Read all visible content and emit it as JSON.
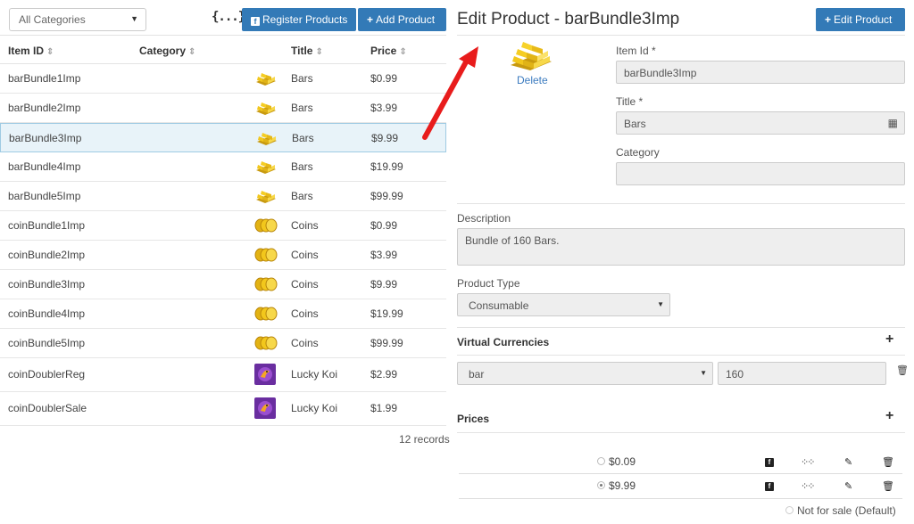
{
  "toolbar": {
    "category_select": "All Categories",
    "json_label": "{...}",
    "register_button": "Register Products",
    "add_button": "Add Product"
  },
  "table": {
    "headers": {
      "item_id": "Item ID",
      "category": "Category",
      "title": "Title",
      "price": "Price"
    },
    "rows": [
      {
        "id": "barBundle1Imp",
        "title": "Bars",
        "price": "$0.99",
        "icon": "gold-bars-icon"
      },
      {
        "id": "barBundle2Imp",
        "title": "Bars",
        "price": "$3.99",
        "icon": "gold-bars-icon"
      },
      {
        "id": "barBundle3Imp",
        "title": "Bars",
        "price": "$9.99",
        "icon": "gold-bars-icon"
      },
      {
        "id": "barBundle4Imp",
        "title": "Bars",
        "price": "$19.99",
        "icon": "gold-bars-icon"
      },
      {
        "id": "barBundle5Imp",
        "title": "Bars",
        "price": "$99.99",
        "icon": "gold-bars-icon"
      },
      {
        "id": "coinBundle1Imp",
        "title": "Coins",
        "price": "$0.99",
        "icon": "gold-coins-icon"
      },
      {
        "id": "coinBundle2Imp",
        "title": "Coins",
        "price": "$3.99",
        "icon": "gold-coins-icon"
      },
      {
        "id": "coinBundle3Imp",
        "title": "Coins",
        "price": "$9.99",
        "icon": "gold-coins-icon"
      },
      {
        "id": "coinBundle4Imp",
        "title": "Coins",
        "price": "$19.99",
        "icon": "gold-coins-icon"
      },
      {
        "id": "coinBundle5Imp",
        "title": "Coins",
        "price": "$99.99",
        "icon": "gold-coins-icon"
      },
      {
        "id": "coinDoublerReg",
        "title": "Lucky Koi",
        "price": "$2.99",
        "icon": "lucky-koi-icon"
      },
      {
        "id": "coinDoublerSale",
        "title": "Lucky Koi",
        "price": "$1.99",
        "icon": "lucky-koi-icon"
      }
    ],
    "selected_index": 2,
    "records": "12 records"
  },
  "editor": {
    "title": "Edit Product - barBundle3Imp",
    "edit_button": "Edit Product",
    "delete_link": "Delete",
    "item_id_label": "Item Id *",
    "item_id_value": "barBundle3Imp",
    "title_label": "Title *",
    "title_value": "Bars",
    "category_label": "Category",
    "category_value": "",
    "description_label": "Description",
    "description_value": "Bundle of 160 Bars.",
    "product_type_label": "Product Type",
    "product_type_value": "Consumable",
    "virtual_currencies_label": "Virtual Currencies",
    "currency_value": "bar",
    "currency_amount": "160",
    "prices_label": "Prices",
    "prices": [
      {
        "value": "$0.09",
        "selected": false
      },
      {
        "value": "$9.99",
        "selected": true
      }
    ],
    "not_for_sale": "Not for sale (Default)"
  },
  "colors": {
    "accent": "#337ab7",
    "selected_row": "#e8f3f9",
    "arrow": "#e81c1c",
    "link": "#3b7bbf"
  }
}
